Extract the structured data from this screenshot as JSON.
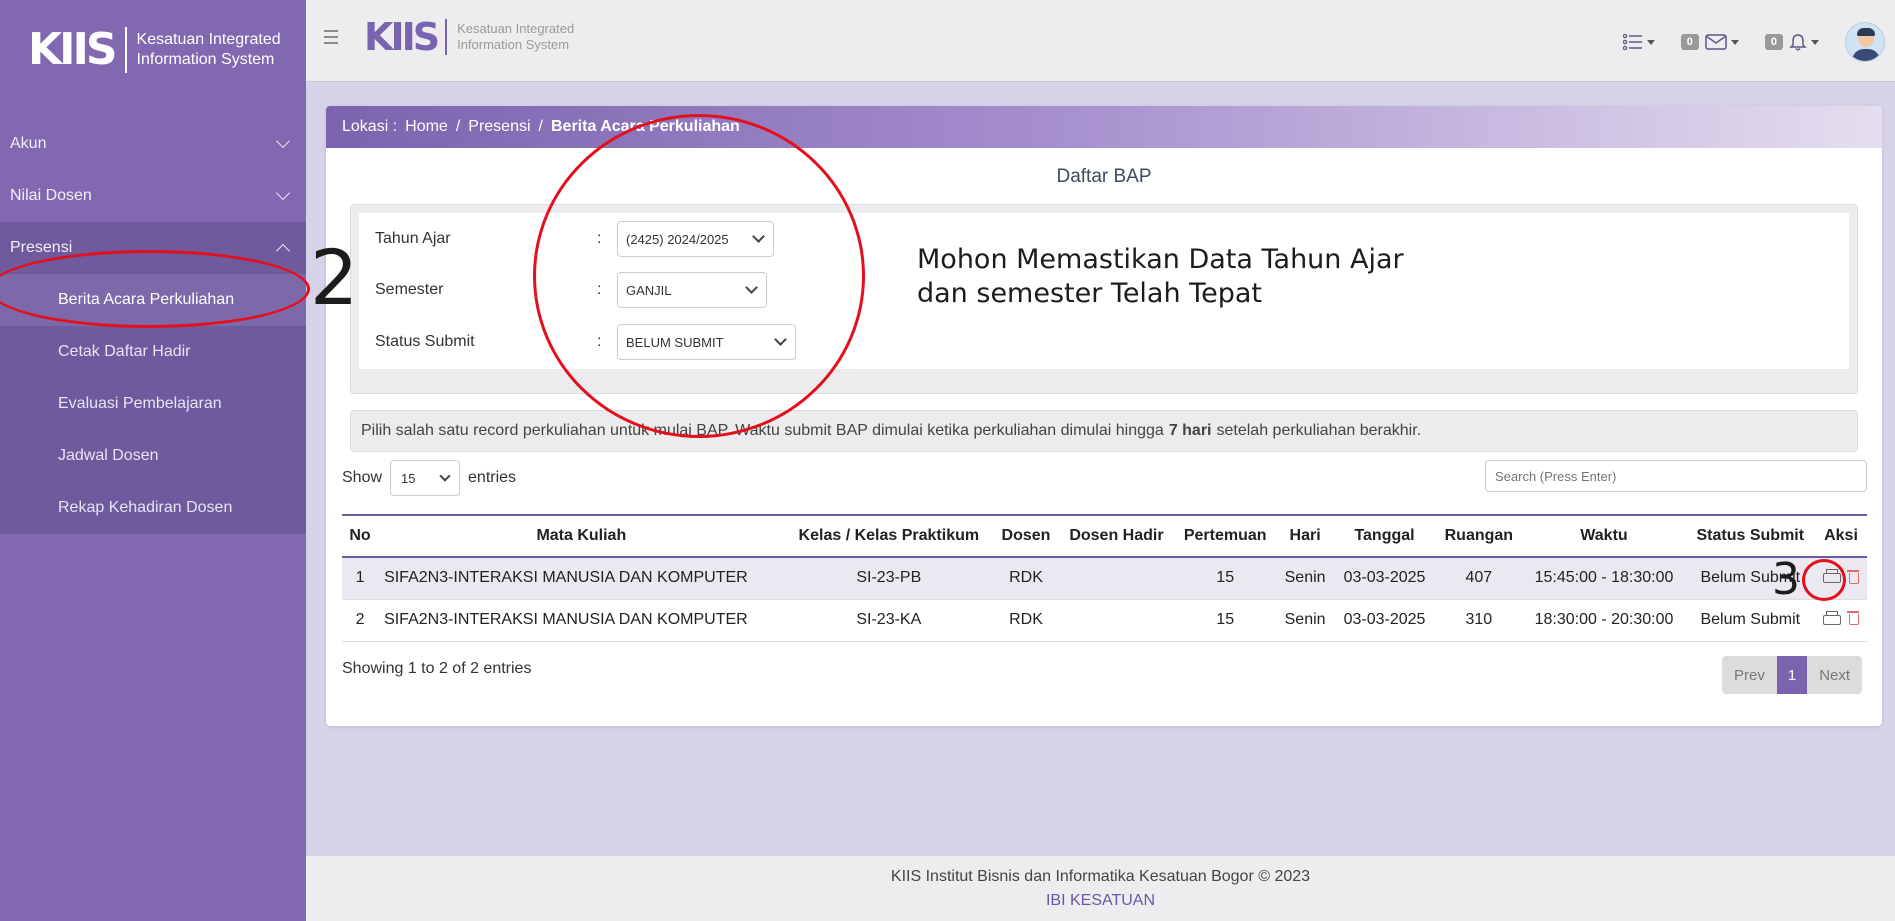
{
  "brand": {
    "logo": "KIIS",
    "line1": "Kesatuan Integrated",
    "line2": "Information System"
  },
  "sidebar": {
    "items": [
      {
        "label": "Akun"
      },
      {
        "label": "Nilai Dosen"
      },
      {
        "label": "Presensi"
      }
    ],
    "sub_items": [
      {
        "label": "Berita Acara Perkuliahan",
        "active": true
      },
      {
        "label": "Cetak Daftar Hadir"
      },
      {
        "label": "Evaluasi Pembelajaran"
      },
      {
        "label": "Jadwal Dosen"
      },
      {
        "label": "Rekap Kehadiran Dosen"
      }
    ]
  },
  "topbar": {
    "icons": [
      "list-icon",
      "envelope-icon",
      "bell-icon"
    ],
    "mail_count": "0",
    "notif_count": "0"
  },
  "breadcrumb": {
    "prefix": "Lokasi :",
    "home": "Home",
    "sep": "/",
    "presensi": "Presensi",
    "current": "Berita Acara Perkuliahan"
  },
  "main": {
    "title": "Daftar BAP",
    "filters": {
      "tahun_ajar": {
        "label": "Tahun Ajar",
        "value": "(2425) 2024/2025"
      },
      "semester": {
        "label": "Semester",
        "value": "GANJIL"
      },
      "status_submit": {
        "label": "Status Submit",
        "value": "BELUM SUBMIT"
      },
      "colon": ":"
    },
    "info": {
      "before": "Pilih salah satu record perkuliahan untuk mulai BAP. Waktu submit BAP dimulai ketika perkuliahan dimulai hingga",
      "bold": "7 hari",
      "after": "setelah perkuliahan berakhir."
    },
    "show": {
      "label_before": "Show",
      "value": "15",
      "label_after": "entries"
    },
    "search": {
      "placeholder": "Search (Press Enter)"
    },
    "table": {
      "headers": [
        "No",
        "Mata Kuliah",
        "Kelas / Kelas Praktikum",
        "Dosen",
        "Dosen Hadir",
        "Pertemuan",
        "Hari",
        "Tanggal",
        "Ruangan",
        "Waktu",
        "Status Submit",
        "Aksi"
      ],
      "rows": [
        {
          "no": "1",
          "mk": "SIFA2N3-INTERAKSI MANUSIA DAN KOMPUTER",
          "kelas": "SI-23-PB",
          "dosen": "RDK",
          "hadir": "",
          "pertemuan": "15",
          "hari": "Senin",
          "tanggal": "03-03-2025",
          "ruangan": "407",
          "waktu": "15:45:00 - 18:30:00",
          "status": "Belum Submit"
        },
        {
          "no": "2",
          "mk": "SIFA2N3-INTERAKSI MANUSIA DAN KOMPUTER",
          "kelas": "SI-23-KA",
          "dosen": "RDK",
          "hadir": "",
          "pertemuan": "15",
          "hari": "Senin",
          "tanggal": "03-03-2025",
          "ruangan": "310",
          "waktu": "18:30:00 - 20:30:00",
          "status": "Belum Submit"
        }
      ]
    },
    "showing": "Showing 1 to 2 of 2 entries",
    "pager": {
      "prev": "Prev",
      "page": "1",
      "next": "Next"
    }
  },
  "annotations": {
    "note_line1": "Mohon Memastikan Data Tahun Ajar",
    "note_line2": "dan semester Telah Tepat",
    "num2": "2",
    "num3": "3"
  },
  "footer": {
    "line1": "KIIS Institut Bisnis dan Informatika Kesatuan Bogor © 2023",
    "line2": "IBI KESATUAN"
  },
  "colors": {
    "sidebar": "#8268b0",
    "accent": "#7b63ae",
    "annotation": "#e3101b"
  }
}
